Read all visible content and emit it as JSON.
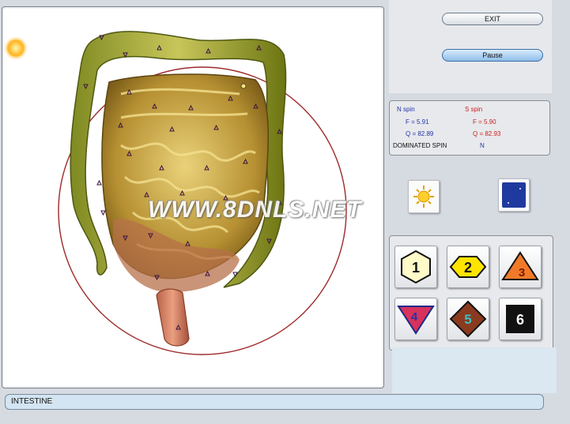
{
  "viewer": {
    "watermark": "WWW.8DNLS.NET",
    "organ_image": "intestine-illustration"
  },
  "controls": {
    "exit_label": "EXIT",
    "pause_label": "Pause"
  },
  "spin": {
    "n_title": "N spin",
    "s_title": "S spin",
    "n_f": "F =  5.91",
    "n_q": "Q = 82.89",
    "s_f": "F =  5.90",
    "s_q": "Q = 82.93",
    "dominated_label": "DOMINATED SPIN",
    "dominated_value": "N",
    "n_color": "#2233aa",
    "s_color": "#cc2222"
  },
  "modes": {
    "day_icon": "sun-icon",
    "night_icon": "moon-icon"
  },
  "levels": [
    {
      "label": "1",
      "shape": "hexagon",
      "color": "#fffbc8"
    },
    {
      "label": "2",
      "shape": "hexagon",
      "color": "#ffe400"
    },
    {
      "label": "3",
      "shape": "triangle",
      "color": "#f07a2a"
    },
    {
      "label": "4",
      "shape": "inverted-triangle",
      "color": "#d6325c"
    },
    {
      "label": "5",
      "shape": "diamond",
      "color": "#8a3a1e"
    },
    {
      "label": "6",
      "shape": "square",
      "color": "#111111"
    }
  ],
  "status": {
    "organ_name": "INTESTINE"
  }
}
